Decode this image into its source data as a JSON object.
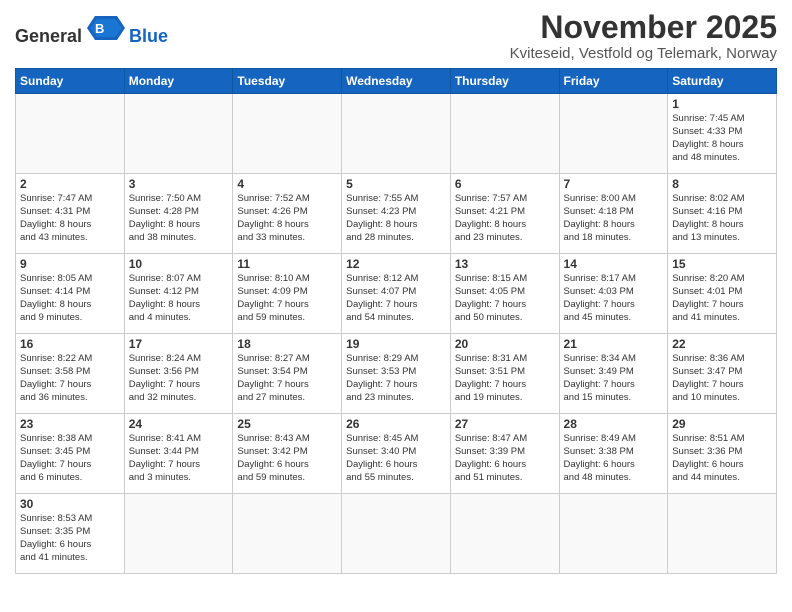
{
  "header": {
    "logo": {
      "text_general": "General",
      "text_blue": "Blue"
    },
    "month_title": "November 2025",
    "subtitle": "Kviteseid, Vestfold og Telemark, Norway"
  },
  "weekdays": [
    "Sunday",
    "Monday",
    "Tuesday",
    "Wednesday",
    "Thursday",
    "Friday",
    "Saturday"
  ],
  "weeks": [
    [
      {
        "day": "",
        "info": ""
      },
      {
        "day": "",
        "info": ""
      },
      {
        "day": "",
        "info": ""
      },
      {
        "day": "",
        "info": ""
      },
      {
        "day": "",
        "info": ""
      },
      {
        "day": "",
        "info": ""
      },
      {
        "day": "1",
        "info": "Sunrise: 7:45 AM\nSunset: 4:33 PM\nDaylight: 8 hours\nand 48 minutes."
      }
    ],
    [
      {
        "day": "2",
        "info": "Sunrise: 7:47 AM\nSunset: 4:31 PM\nDaylight: 8 hours\nand 43 minutes."
      },
      {
        "day": "3",
        "info": "Sunrise: 7:50 AM\nSunset: 4:28 PM\nDaylight: 8 hours\nand 38 minutes."
      },
      {
        "day": "4",
        "info": "Sunrise: 7:52 AM\nSunset: 4:26 PM\nDaylight: 8 hours\nand 33 minutes."
      },
      {
        "day": "5",
        "info": "Sunrise: 7:55 AM\nSunset: 4:23 PM\nDaylight: 8 hours\nand 28 minutes."
      },
      {
        "day": "6",
        "info": "Sunrise: 7:57 AM\nSunset: 4:21 PM\nDaylight: 8 hours\nand 23 minutes."
      },
      {
        "day": "7",
        "info": "Sunrise: 8:00 AM\nSunset: 4:18 PM\nDaylight: 8 hours\nand 18 minutes."
      },
      {
        "day": "8",
        "info": "Sunrise: 8:02 AM\nSunset: 4:16 PM\nDaylight: 8 hours\nand 13 minutes."
      }
    ],
    [
      {
        "day": "9",
        "info": "Sunrise: 8:05 AM\nSunset: 4:14 PM\nDaylight: 8 hours\nand 9 minutes."
      },
      {
        "day": "10",
        "info": "Sunrise: 8:07 AM\nSunset: 4:12 PM\nDaylight: 8 hours\nand 4 minutes."
      },
      {
        "day": "11",
        "info": "Sunrise: 8:10 AM\nSunset: 4:09 PM\nDaylight: 7 hours\nand 59 minutes."
      },
      {
        "day": "12",
        "info": "Sunrise: 8:12 AM\nSunset: 4:07 PM\nDaylight: 7 hours\nand 54 minutes."
      },
      {
        "day": "13",
        "info": "Sunrise: 8:15 AM\nSunset: 4:05 PM\nDaylight: 7 hours\nand 50 minutes."
      },
      {
        "day": "14",
        "info": "Sunrise: 8:17 AM\nSunset: 4:03 PM\nDaylight: 7 hours\nand 45 minutes."
      },
      {
        "day": "15",
        "info": "Sunrise: 8:20 AM\nSunset: 4:01 PM\nDaylight: 7 hours\nand 41 minutes."
      }
    ],
    [
      {
        "day": "16",
        "info": "Sunrise: 8:22 AM\nSunset: 3:58 PM\nDaylight: 7 hours\nand 36 minutes."
      },
      {
        "day": "17",
        "info": "Sunrise: 8:24 AM\nSunset: 3:56 PM\nDaylight: 7 hours\nand 32 minutes."
      },
      {
        "day": "18",
        "info": "Sunrise: 8:27 AM\nSunset: 3:54 PM\nDaylight: 7 hours\nand 27 minutes."
      },
      {
        "day": "19",
        "info": "Sunrise: 8:29 AM\nSunset: 3:53 PM\nDaylight: 7 hours\nand 23 minutes."
      },
      {
        "day": "20",
        "info": "Sunrise: 8:31 AM\nSunset: 3:51 PM\nDaylight: 7 hours\nand 19 minutes."
      },
      {
        "day": "21",
        "info": "Sunrise: 8:34 AM\nSunset: 3:49 PM\nDaylight: 7 hours\nand 15 minutes."
      },
      {
        "day": "22",
        "info": "Sunrise: 8:36 AM\nSunset: 3:47 PM\nDaylight: 7 hours\nand 10 minutes."
      }
    ],
    [
      {
        "day": "23",
        "info": "Sunrise: 8:38 AM\nSunset: 3:45 PM\nDaylight: 7 hours\nand 6 minutes."
      },
      {
        "day": "24",
        "info": "Sunrise: 8:41 AM\nSunset: 3:44 PM\nDaylight: 7 hours\nand 3 minutes."
      },
      {
        "day": "25",
        "info": "Sunrise: 8:43 AM\nSunset: 3:42 PM\nDaylight: 6 hours\nand 59 minutes."
      },
      {
        "day": "26",
        "info": "Sunrise: 8:45 AM\nSunset: 3:40 PM\nDaylight: 6 hours\nand 55 minutes."
      },
      {
        "day": "27",
        "info": "Sunrise: 8:47 AM\nSunset: 3:39 PM\nDaylight: 6 hours\nand 51 minutes."
      },
      {
        "day": "28",
        "info": "Sunrise: 8:49 AM\nSunset: 3:38 PM\nDaylight: 6 hours\nand 48 minutes."
      },
      {
        "day": "29",
        "info": "Sunrise: 8:51 AM\nSunset: 3:36 PM\nDaylight: 6 hours\nand 44 minutes."
      }
    ],
    [
      {
        "day": "30",
        "info": "Sunrise: 8:53 AM\nSunset: 3:35 PM\nDaylight: 6 hours\nand 41 minutes."
      },
      {
        "day": "",
        "info": ""
      },
      {
        "day": "",
        "info": ""
      },
      {
        "day": "",
        "info": ""
      },
      {
        "day": "",
        "info": ""
      },
      {
        "day": "",
        "info": ""
      },
      {
        "day": "",
        "info": ""
      }
    ]
  ]
}
